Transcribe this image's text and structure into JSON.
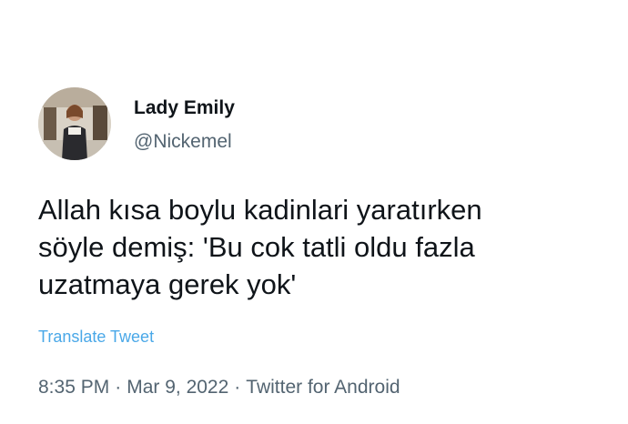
{
  "user": {
    "name": "Lady Emily",
    "handle": "@Nickemel"
  },
  "tweet": {
    "text_lines": [
      "Allah kısa boylu kadinlari yaratırken",
      "söyle demiş: 'Bu cok tatli oldu fazla",
      "uzatmaya gerek yok'"
    ],
    "translate_label": "Translate Tweet",
    "time": "8:35 PM",
    "date": "Mar 9, 2022",
    "source": "Twitter for Android",
    "separator": "·"
  },
  "colors": {
    "text": "#0f1419",
    "secondary": "#536471",
    "link": "#4aa8e8"
  },
  "icons": {
    "avatar": "profile-photo"
  }
}
